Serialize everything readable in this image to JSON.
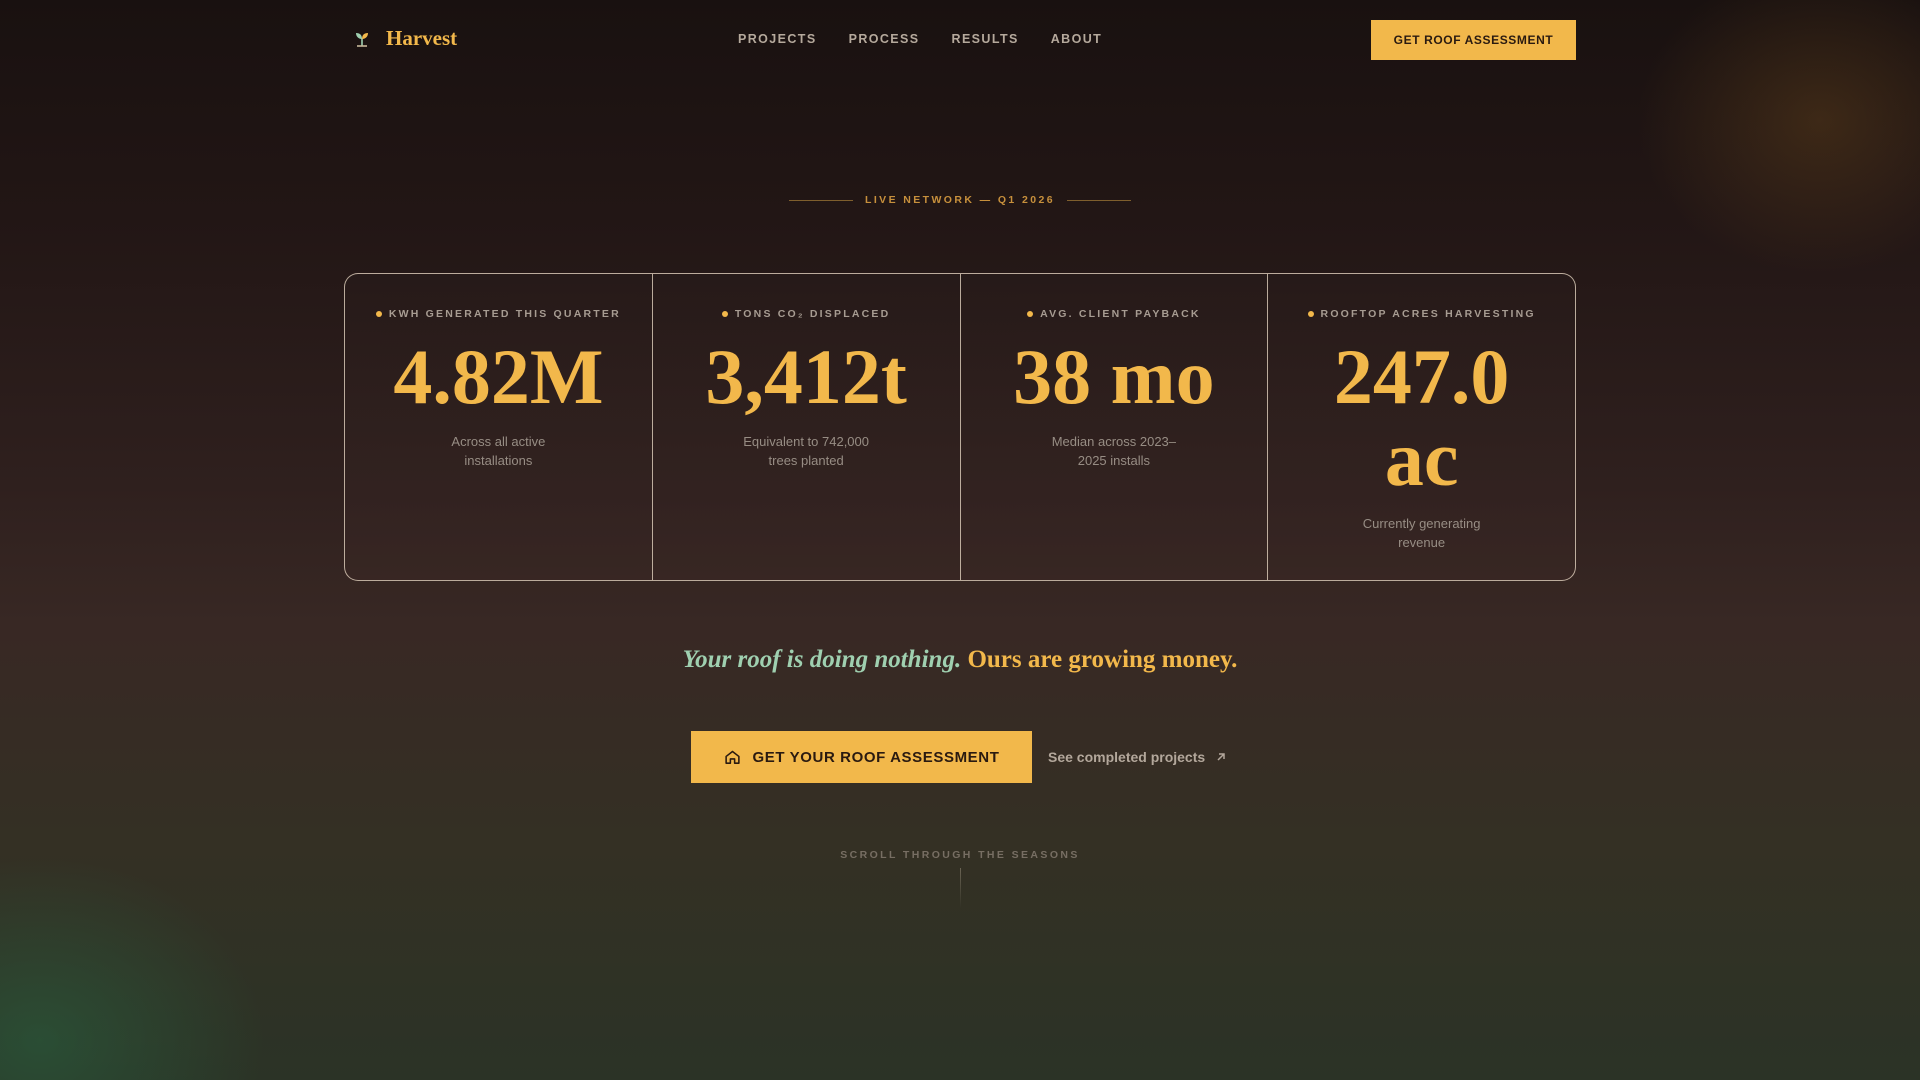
{
  "nav": {
    "brand": "Harvest",
    "brand_icon": "leaf-sprout-icon",
    "links": [
      "PROJECTS",
      "PROCESS",
      "RESULTS",
      "ABOUT"
    ],
    "cta_label": "GET ROOF ASSESSMENT"
  },
  "hero": {
    "eyebrow": "LIVE NETWORK — Q1 2026",
    "stats": [
      {
        "label": "KWH GENERATED THIS QUARTER",
        "value": "4.82M",
        "description": "Across all active installations"
      },
      {
        "label": "TONS CO₂ DISPLACED",
        "value": "3,412t",
        "description": "Equivalent to 742,000 trees planted"
      },
      {
        "label": "AVG. CLIENT PAYBACK",
        "value": "38 mo",
        "description": "Median across 2023–2025 installs"
      },
      {
        "label": "ROOFTOP ACRES HARVESTING",
        "value": "247.0 ac",
        "description": "Currently generating revenue"
      }
    ],
    "tagline_italic": "Your roof is doing nothing.",
    "tagline_bold": "Ours are growing money.",
    "cta_primary": "GET YOUR ROOF ASSESSMENT",
    "cta_primary_icon": "home-icon",
    "cta_secondary": "See completed projects",
    "cta_secondary_icon": "arrow-up-right-icon",
    "scroll_hint": "SCROLL THROUGH THE SEASONS"
  },
  "colors": {
    "accent": "#f2b84b",
    "tagline_italic": "#9fd0b0",
    "background_top": "#191110",
    "background_bottom": "#2b3326"
  }
}
